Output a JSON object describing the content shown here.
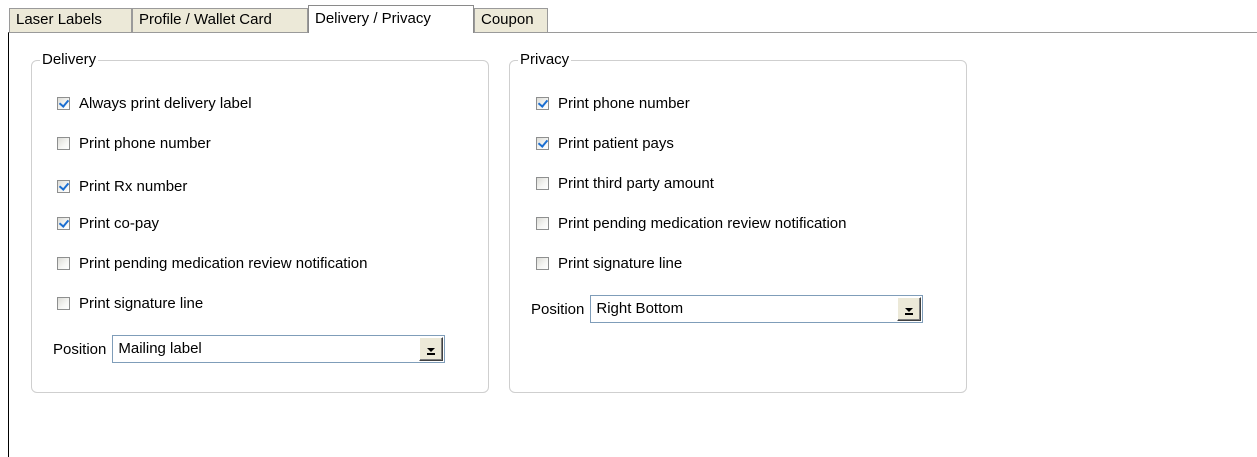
{
  "tabs": [
    {
      "label": "Laser Labels"
    },
    {
      "label": "Profile / Wallet Card"
    },
    {
      "label": "Delivery / Privacy",
      "active": true
    },
    {
      "label": "Coupon"
    }
  ],
  "delivery": {
    "title": "Delivery",
    "options": [
      {
        "label": "Always print delivery label",
        "checked": true
      },
      {
        "label": "Print phone number",
        "checked": false
      },
      {
        "label": "Print Rx number",
        "checked": true
      },
      {
        "label": "Print co-pay",
        "checked": true
      },
      {
        "label": "Print pending medication review notification",
        "checked": false
      },
      {
        "label": "Print signature line",
        "checked": false
      }
    ],
    "position_label": "Position",
    "position_value": "Mailing label"
  },
  "privacy": {
    "title": "Privacy",
    "options": [
      {
        "label": "Print phone number",
        "checked": true
      },
      {
        "label": "Print patient pays",
        "checked": true
      },
      {
        "label": "Print third party amount",
        "checked": false
      },
      {
        "label": "Print pending medication review notification",
        "checked": false
      },
      {
        "label": "Print signature line",
        "checked": false
      }
    ],
    "position_label": "Position",
    "position_value": "Right Bottom"
  }
}
